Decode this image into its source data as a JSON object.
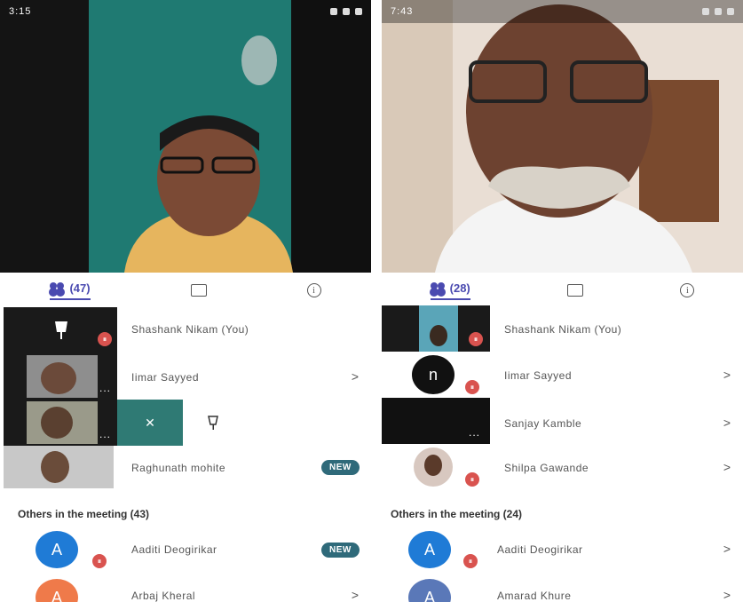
{
  "left": {
    "status": {
      "time": "3:15"
    },
    "tabs": {
      "people_count": "(47)"
    },
    "participants": [
      {
        "name": "Shashank Nikam (You)"
      },
      {
        "name": "Iimar Sayyed",
        "chevron": ">"
      },
      {
        "name": "",
        "close_symbol": "✕"
      },
      {
        "name": "Raghunath mohite",
        "badge": "NEW"
      }
    ],
    "others_heading": "Others in the meeting (43)",
    "others": [
      {
        "initial": "A",
        "name": "Aaditi Deogirikar",
        "badge": "NEW"
      },
      {
        "initial": "A",
        "name": "Arbaj Kheral",
        "chevron": ">"
      }
    ]
  },
  "right": {
    "status": {
      "time": "7:43"
    },
    "tabs": {
      "people_count": "(28)"
    },
    "participants": [
      {
        "name": "Shashank Nikam (You)"
      },
      {
        "initial": "n",
        "name": "Iimar Sayyed",
        "chevron": ">"
      },
      {
        "name": "Sanjay Kamble",
        "chevron": ">"
      },
      {
        "name": "Shilpa Gawande",
        "chevron": ">"
      }
    ],
    "others_heading": "Others in the meeting (24)",
    "others": [
      {
        "initial": "A",
        "name": "Aaditi Deogirikar",
        "chevron": ">"
      },
      {
        "initial": "A",
        "name": "Amarad Khure",
        "chevron": ">"
      }
    ]
  },
  "colors": {
    "accent": "#4a4ab0",
    "new_badge": "#2f6a7a",
    "muted_mic": "#d9534f",
    "avatar_blue": "#1f7bd6",
    "avatar_orange": "#ef7a4a"
  }
}
